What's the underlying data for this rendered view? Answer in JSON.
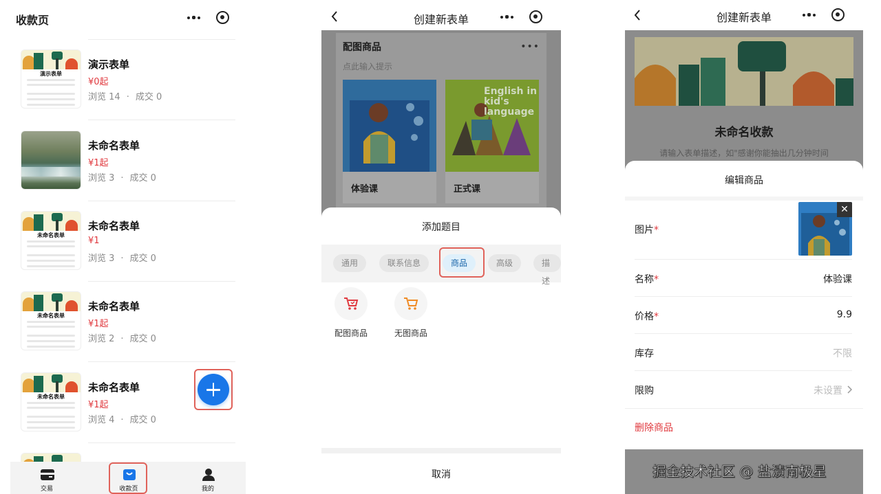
{
  "panel1": {
    "title": "收款页",
    "items": [
      {
        "name": "演示表单",
        "price": "¥0起",
        "views": "浏览 14",
        "deals": "成交 0",
        "thumb_title": "演示表单",
        "thumb_type": "banner"
      },
      {
        "name": "未命名表单",
        "price": "¥1起",
        "views": "浏览 3",
        "deals": "成交 0",
        "thumb_title": "",
        "thumb_type": "photo"
      },
      {
        "name": "未命名表单",
        "price": "¥1",
        "views": "浏览 3",
        "deals": "成交 0",
        "thumb_title": "未命名表单",
        "thumb_type": "banner"
      },
      {
        "name": "未命名表单",
        "price": "¥1起",
        "views": "浏览 2",
        "deals": "成交 0",
        "thumb_title": "未命名表单",
        "thumb_type": "banner"
      },
      {
        "name": "未命名表单",
        "price": "¥1起",
        "views": "浏览 4",
        "deals": "成交 0",
        "thumb_title": "未命名表单",
        "thumb_type": "banner"
      }
    ],
    "stat_separator": "·",
    "tabs": [
      {
        "label": "交易",
        "icon": "wallet-icon"
      },
      {
        "label": "收款页",
        "icon": "bag-icon"
      },
      {
        "label": "我的",
        "icon": "person-icon"
      }
    ]
  },
  "panel2": {
    "title": "创建新表单",
    "card_title": "配图商品",
    "card_hint": "点此输入提示",
    "products": [
      {
        "label": "体验课",
        "image_text": ""
      },
      {
        "label": "正式课",
        "image_text": "English in kid's language"
      }
    ],
    "sheet_title": "添加题目",
    "chips": [
      "通用",
      "联系信息",
      "商品",
      "高级",
      "描述"
    ],
    "active_chip": "商品",
    "options": [
      {
        "label": "配图商品",
        "icon": "cart-image-icon"
      },
      {
        "label": "无图商品",
        "icon": "cart-icon"
      }
    ],
    "cancel": "取消"
  },
  "panel3": {
    "form_title": "未命名收款",
    "form_desc": "请输入表单描述，如\"感谢你能抽出几分钟时间",
    "sheet_title": "编辑商品",
    "rows": {
      "image_label": "图片",
      "name_label": "名称",
      "name_value": "体验课",
      "price_label": "价格",
      "price_value": "9.9",
      "stock_label": "库存",
      "stock_value": "不限",
      "limit_label": "限购",
      "limit_value": "未设置",
      "required_mark": "*"
    },
    "delete": "删除商品"
  },
  "watermark": "掘金技术社区 @ 盐渍南极星",
  "colors": {
    "accent": "#1976e8",
    "price": "#e0393e",
    "highlight_box": "#e0625a"
  }
}
